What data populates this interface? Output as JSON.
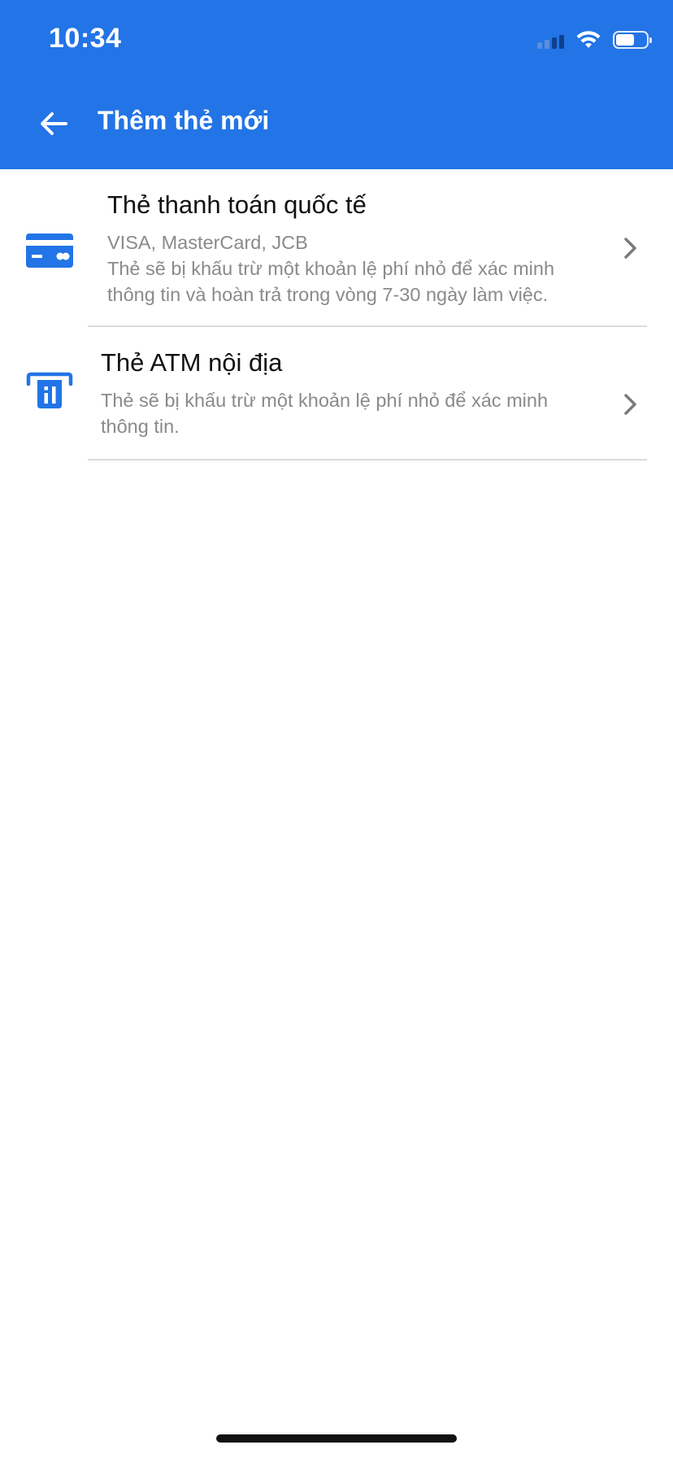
{
  "status_bar": {
    "time": "10:34"
  },
  "header": {
    "title": "Thêm thẻ mới",
    "back_icon": "arrow-left-icon",
    "background_color": "#2374E6"
  },
  "items": [
    {
      "icon": "credit-card-icon",
      "title": "Thẻ thanh toán quốc tế",
      "subtitle": "VISA, MasterCard, JCB",
      "description": "Thẻ sẽ bị khấu trừ một khoản lệ phí nhỏ để xác minh thông tin và hoàn trả trong vòng 7-30 ngày làm việc."
    },
    {
      "icon": "atm-icon",
      "title": "Thẻ ATM nội địa",
      "description": "Thẻ sẽ bị khấu trừ một khoản lệ phí nhỏ để xác minh thông tin."
    }
  ],
  "colors": {
    "accent": "#2374E6",
    "title_text": "#111111",
    "secondary_text": "#8A8A8A",
    "divider": "#DCDCDC"
  }
}
